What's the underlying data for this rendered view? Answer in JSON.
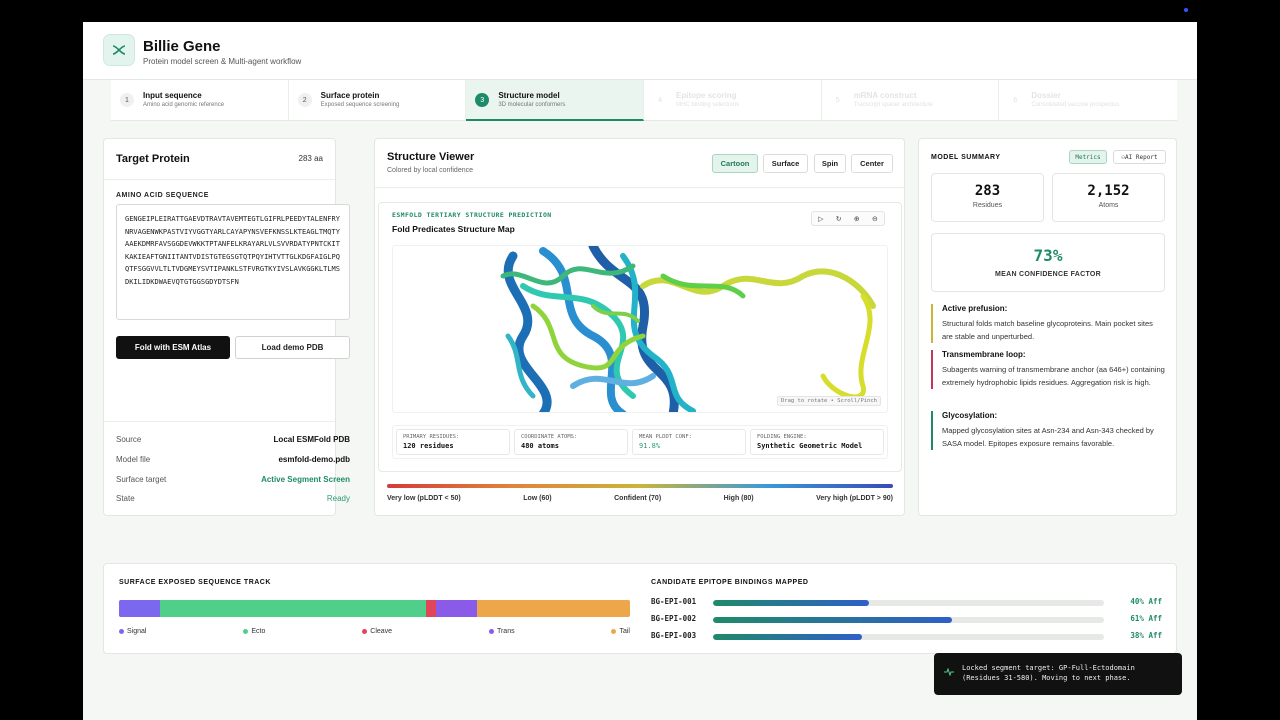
{
  "brand": {
    "title": "Billie Gene",
    "subtitle": "Protein model screen & Multi-agent workflow"
  },
  "steps": [
    {
      "num": "1",
      "label": "Input sequence",
      "sub": "Amino acid genomic reference"
    },
    {
      "num": "2",
      "label": "Surface protein",
      "sub": "Exposed sequence screening"
    },
    {
      "num": "3",
      "label": "Structure model",
      "sub": "3D molecular conformers"
    },
    {
      "num": "4",
      "label": "Epitope scoring",
      "sub": "MHC binding selections"
    },
    {
      "num": "5",
      "label": "mRNA construct",
      "sub": "Transcript spacer architecture"
    },
    {
      "num": "6",
      "label": "Dossier",
      "sub": "Consolidated vaccine prospectus"
    }
  ],
  "target": {
    "title": "Target Protein",
    "count": "283 aa",
    "seq_label": "AMINO ACID SEQUENCE",
    "sequence": "GENGEIPLEIRATTGAEVDTRAVTAVEMTEGTLGIFRLPEEDYTALENFRYNRVAGENWKPASTVIYVGGTYARLCAYAPYNSVEFKNSSLKTEAGLTMQTYAAEKDMRFAVSGGDEVWKKTPTANFELKRAYARLVLSVVRDATYPNTCKITKAKIEAFTGNIITANTVDISTGTEGSGTQTPQYIHTVTTGLKDGFAIGLPQQTFSGGVVLTLTVDGMEYSVTIPANKLSTFVRGTKYIVSLAVKGGKLTLMSDKILIDKDWAEVQTGTGGSGDYDTSFN",
    "fold_button": "Fold with ESM Atlas",
    "demo_button": "Load demo PDB",
    "info": [
      {
        "k": "Source",
        "v": "Local ESMFold PDB"
      },
      {
        "k": "Model file",
        "v": "esmfold-demo.pdb"
      },
      {
        "k": "Surface target",
        "v": "Active Segment Screen"
      },
      {
        "k": "State",
        "v": "Ready"
      }
    ]
  },
  "viewer": {
    "title": "Structure Viewer",
    "subtitle": "Colored by local confidence",
    "buttons": [
      "Cartoon",
      "Surface",
      "Spin",
      "Center"
    ],
    "tag": "ESMFOLD TERTIARY STRUCTURE PREDICTION",
    "map_title": "Fold Predicates Structure Map",
    "hint": "Drag to rotate • Scroll/Pinch",
    "stats": [
      {
        "label": "PRIMARY RESIDUES:",
        "value": "120 residues"
      },
      {
        "label": "COORDINATE ATOMS:",
        "value": "480 atoms"
      },
      {
        "label": "MEAN PLDDT CONF:",
        "value": "91.8%"
      },
      {
        "label": "FOLDING ENGINE:",
        "value": "Synthetic Geometric Model"
      }
    ],
    "legend": [
      "Very low (pLDDT < 50)",
      "Low (60)",
      "Confident (70)",
      "High (80)",
      "Very high (pLDDT > 90)"
    ]
  },
  "summary": {
    "title": "MODEL SUMMARY",
    "tabs": [
      "Metrics",
      "AI Report"
    ],
    "residues": {
      "value": "283",
      "label": "Residues"
    },
    "atoms": {
      "value": "2,152",
      "label": "Atoms"
    },
    "confidence": {
      "value": "73%",
      "label": "MEAN CONFIDENCE FACTOR"
    },
    "notes": [
      {
        "title": "Active prefusion:",
        "body": "Structural folds match baseline glycoproteins. Main pocket sites are stable and unperturbed.",
        "color": "#c9b43a"
      },
      {
        "title": "Transmembrane loop:",
        "body": "Subagents warning of transmembrane anchor (aa 646+) containing extremely hydrophobic lipids residues. Aggregation risk is high.",
        "color": "#c2365a"
      },
      {
        "title": "Glycosylation:",
        "body": "Mapped glycosylation sites at Asn-234 and Asn-343 checked by SASA model. Epitopes exposure remains favorable.",
        "color": "#1f8a6a"
      }
    ]
  },
  "track": {
    "title": "SURFACE EXPOSED SEQUENCE TRACK",
    "segments": [
      {
        "name": "Signal",
        "fraction": 0.08,
        "color": "#7b68ee"
      },
      {
        "name": "Ecto",
        "fraction": 0.52,
        "color": "#4fcf8a"
      },
      {
        "name": "Cleave",
        "fraction": 0.02,
        "color": "#e0455a"
      },
      {
        "name": "Trans",
        "fraction": 0.08,
        "color": "#8a5ae8"
      },
      {
        "name": "Tail",
        "fraction": 0.3,
        "color": "#eea64a"
      }
    ]
  },
  "epitopes": {
    "title": "CANDIDATE EPITOPE BINDINGS MAPPED",
    "items": [
      {
        "name": "BG-EPI-001",
        "percent": 40,
        "label": "40% Aff"
      },
      {
        "name": "BG-EPI-002",
        "percent": 61,
        "label": "61% Aff"
      },
      {
        "name": "BG-EPI-003",
        "percent": 38,
        "label": "38% Aff"
      }
    ]
  },
  "toast": {
    "text": "Locked segment target: GP-Full-Ectodomain (Residues 31-580). Moving to next phase."
  },
  "colors": {
    "accent": "#1f8a6a"
  }
}
